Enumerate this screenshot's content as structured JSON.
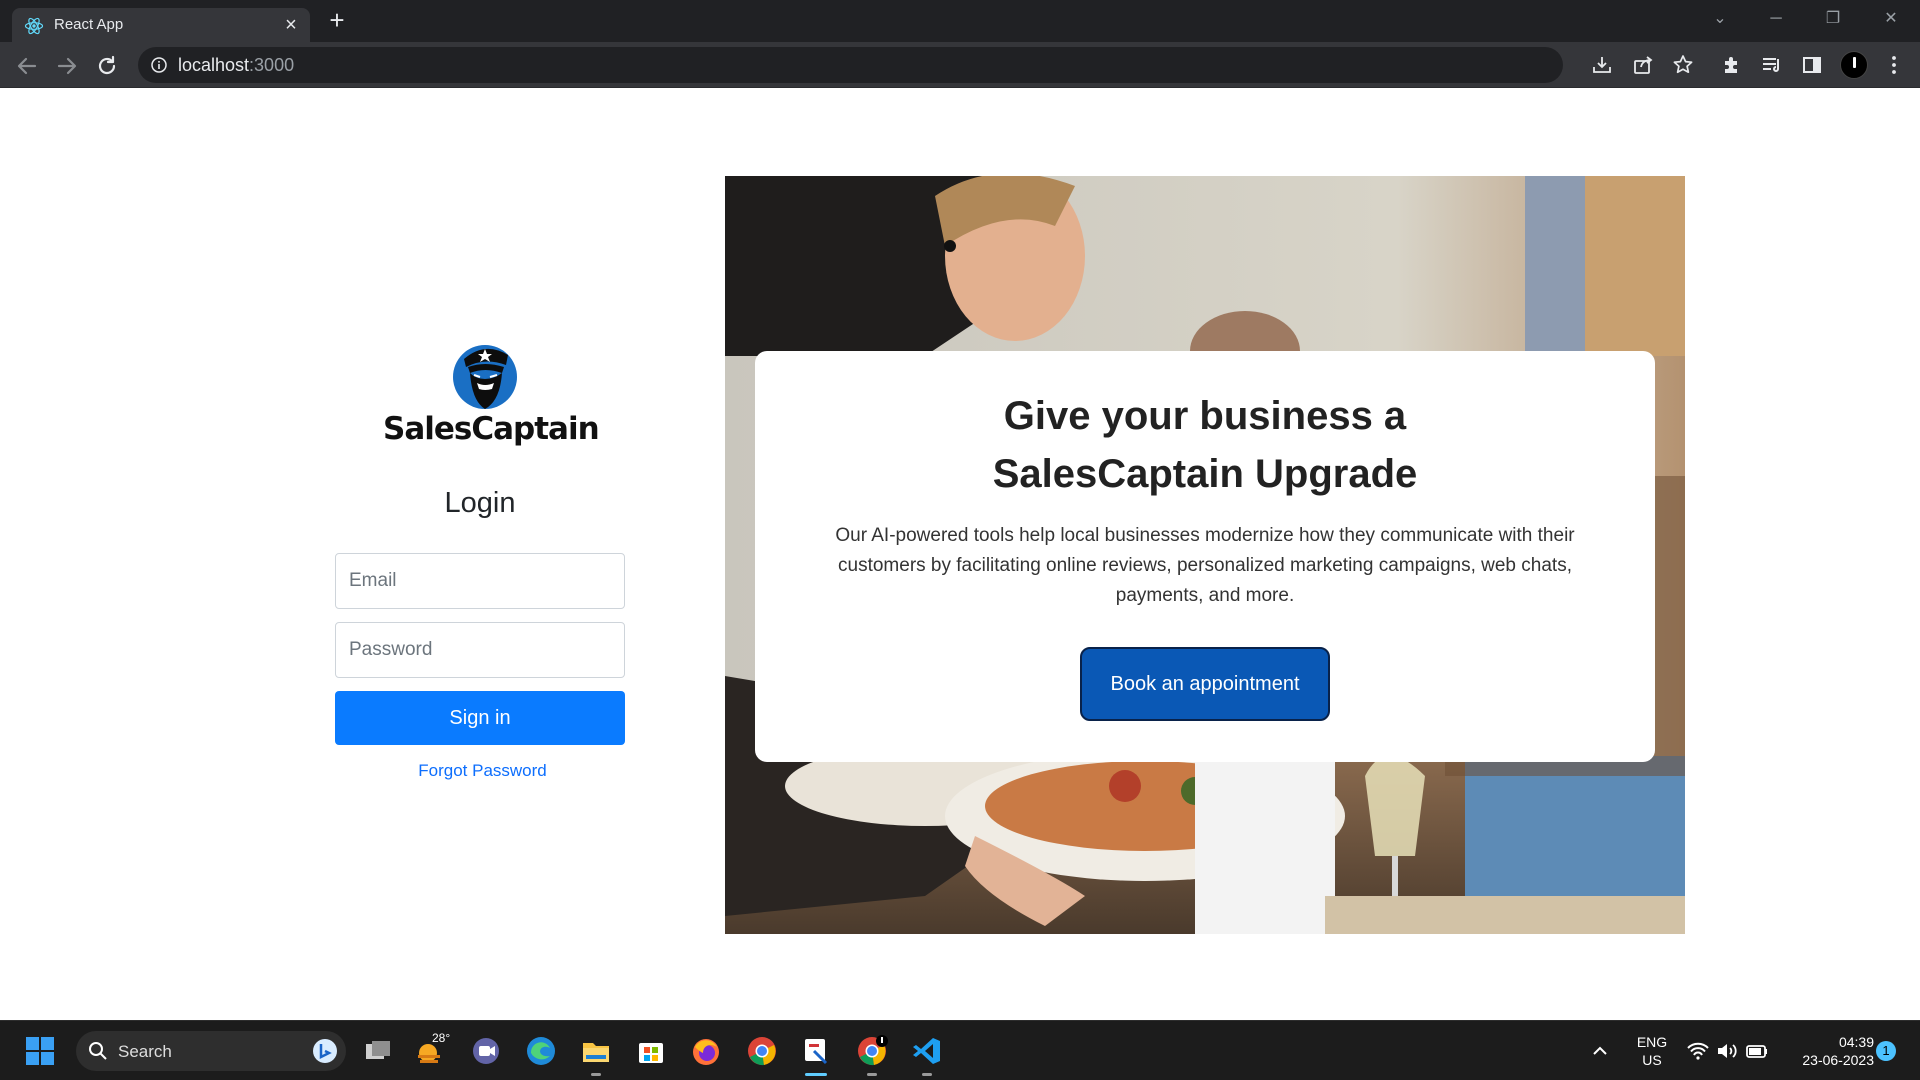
{
  "browser": {
    "tab_title": "React App",
    "url_host": "localhost",
    "url_port": ":3000"
  },
  "login": {
    "brand_name": "SalesCaptain",
    "title": "Login",
    "email_placeholder": "Email",
    "password_placeholder": "Password",
    "signin_label": "Sign in",
    "forgot_label": "Forgot Password"
  },
  "promo": {
    "title_line1": "Give your business a",
    "title_line2": "SalesCaptain Upgrade",
    "body": "Our AI-powered tools help local businesses modernize how they communicate with their customers by facilitating online reviews, personalized marketing campaigns, web chats, payments, and more.",
    "cta_label": "Book an appointment"
  },
  "taskbar": {
    "search_label": "Search",
    "weather_temp": "28°",
    "lang_line1": "ENG",
    "lang_line2": "US",
    "time": "04:39",
    "date": "23-06-2023",
    "notification_count": "1"
  },
  "colors": {
    "primary_button": "#0a7bff",
    "cta_button": "#0a58b5",
    "link": "#0d6efd"
  }
}
